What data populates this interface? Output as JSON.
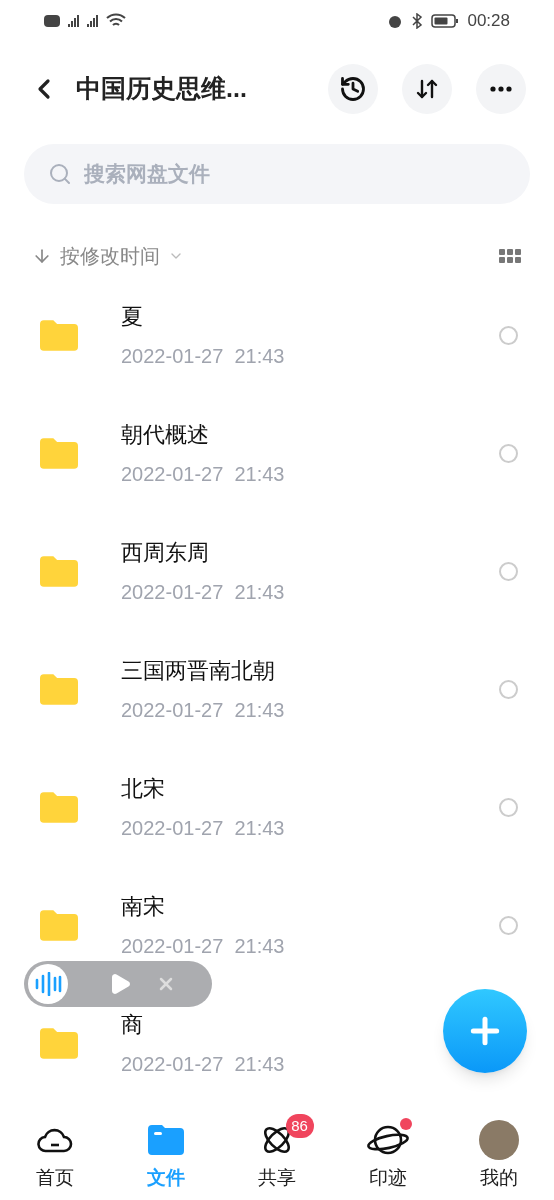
{
  "status_bar": {
    "time": "00:28"
  },
  "header": {
    "title": "中国历史思维..."
  },
  "search": {
    "placeholder": "搜索网盘文件"
  },
  "sort": {
    "label": "按修改时间"
  },
  "files": [
    {
      "name": "夏",
      "modified": "2022-01-27  21:43",
      "selected": false
    },
    {
      "name": "朝代概述",
      "modified": "2022-01-27  21:43",
      "selected": false
    },
    {
      "name": "西周东周",
      "modified": "2022-01-27  21:43",
      "selected": false
    },
    {
      "name": "三国两晋南北朝",
      "modified": "2022-01-27  21:43",
      "selected": false
    },
    {
      "name": "北宋",
      "modified": "2022-01-27  21:43",
      "selected": false
    },
    {
      "name": "南宋",
      "modified": "2022-01-27  21:43",
      "selected": false
    },
    {
      "name": "商",
      "modified": "2022-01-27  21:43"
    }
  ],
  "tabs": [
    {
      "kind": "home",
      "label": "首页",
      "selected": false
    },
    {
      "kind": "files",
      "label": "文件",
      "selected": true
    },
    {
      "kind": "share",
      "label": "共享",
      "selected": false,
      "badge": "86"
    },
    {
      "kind": "planet",
      "label": "印迹",
      "selected": false,
      "dot": true
    },
    {
      "kind": "avatar",
      "label": "我的",
      "selected": false
    }
  ]
}
